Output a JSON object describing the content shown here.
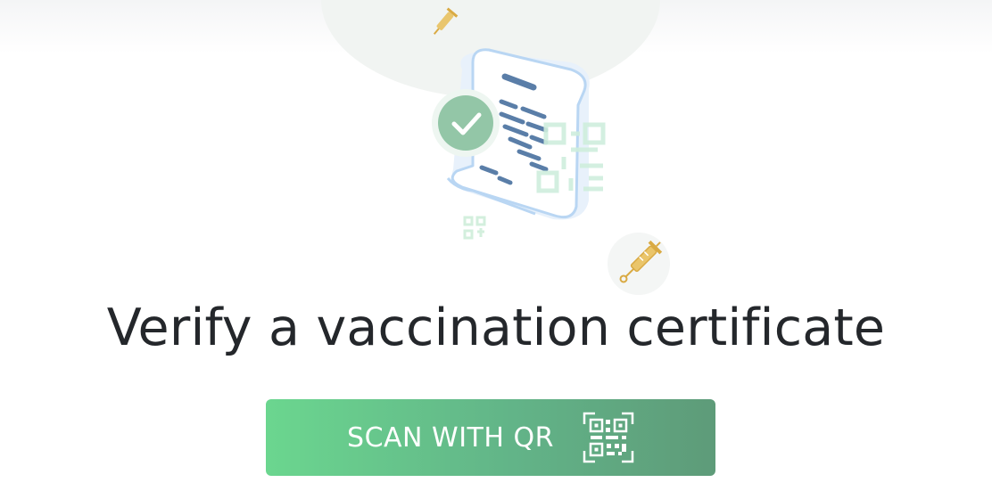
{
  "page": {
    "title": "Verify a vaccination certificate"
  },
  "scan_button": {
    "label": "SCAN WITH QR",
    "icon": "qr-code-icon"
  },
  "colors": {
    "button_gradient_start": "#6bd68f",
    "button_gradient_end": "#5e9b79",
    "title_text": "#24272b",
    "check_badge": "#93c6a7",
    "syringe": "#e0b54a"
  },
  "illustration": {
    "icons": [
      "certificate-document-icon",
      "check-badge-icon",
      "qr-code-icon",
      "syringe-icon"
    ]
  }
}
